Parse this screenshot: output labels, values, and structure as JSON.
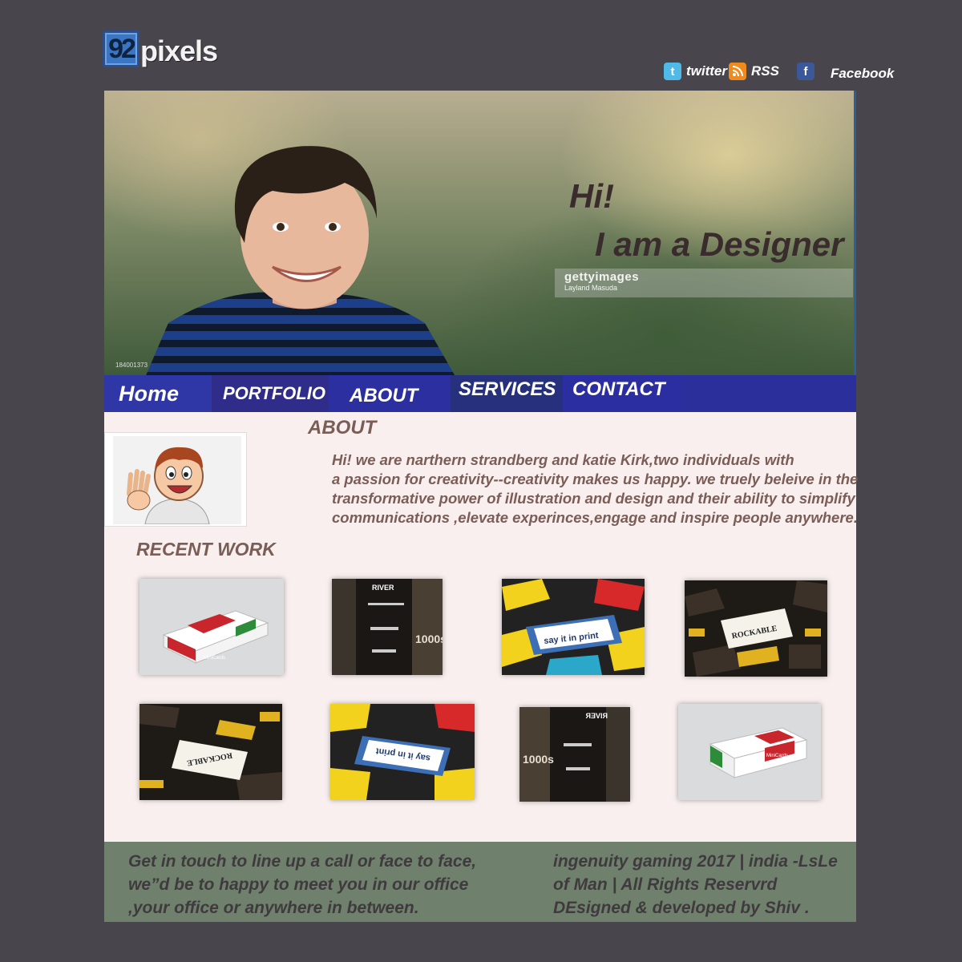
{
  "brand": {
    "logo_number": "92",
    "logo_text": "pixels"
  },
  "social": {
    "twitter": {
      "icon": "twitter-icon",
      "label": "twitter"
    },
    "rss": {
      "icon": "rss-icon",
      "label": "RSS"
    },
    "facebook": {
      "icon": "facebook-icon",
      "label": "Facebook"
    }
  },
  "hero": {
    "greeting": "Hi!",
    "tagline": "I am a Designer",
    "watermark_brand": "gettyimages",
    "watermark_credit": "Layland Masuda",
    "image_id": "184001373"
  },
  "nav": {
    "items": [
      "Home",
      "PORTFOLIO",
      "ABOUT",
      "SERVICES",
      "CONTACT"
    ]
  },
  "about": {
    "title": "ABOUT",
    "lines": [
      "Hi! we are narthern strandberg and katie Kirk,two individuals with",
      " a passion for creativity--creativity makes us happy. we truely beleive in the",
      " transformative power of illustration and design and their ability to simplify",
      "communications ,elevate experinces,engage and inspire people anywhere."
    ]
  },
  "recent_work": {
    "title": "RECENT WORK",
    "thumb_labels": {
      "minicards": "MiniCards",
      "river": "RIVER",
      "print": "say it in print",
      "rockable": "ROCKABLE"
    }
  },
  "footer": {
    "left": [
      "Get in touch to line up a call or face to face,",
      "we”d be to happy to meet you in our office",
      ",your office or anywhere in between."
    ],
    "right": [
      "ingenuity gaming 2017 | india -LsLe",
      "of Man | All Rights Reservrd",
      " DEsigned & developed by Shiv ."
    ]
  },
  "colors": {
    "page_bg": "#48454d",
    "nav_bg": "#2b2f9c",
    "content_bg": "#f8efee",
    "footer_bg": "#6f816c",
    "text_accent": "#7b5d57"
  }
}
